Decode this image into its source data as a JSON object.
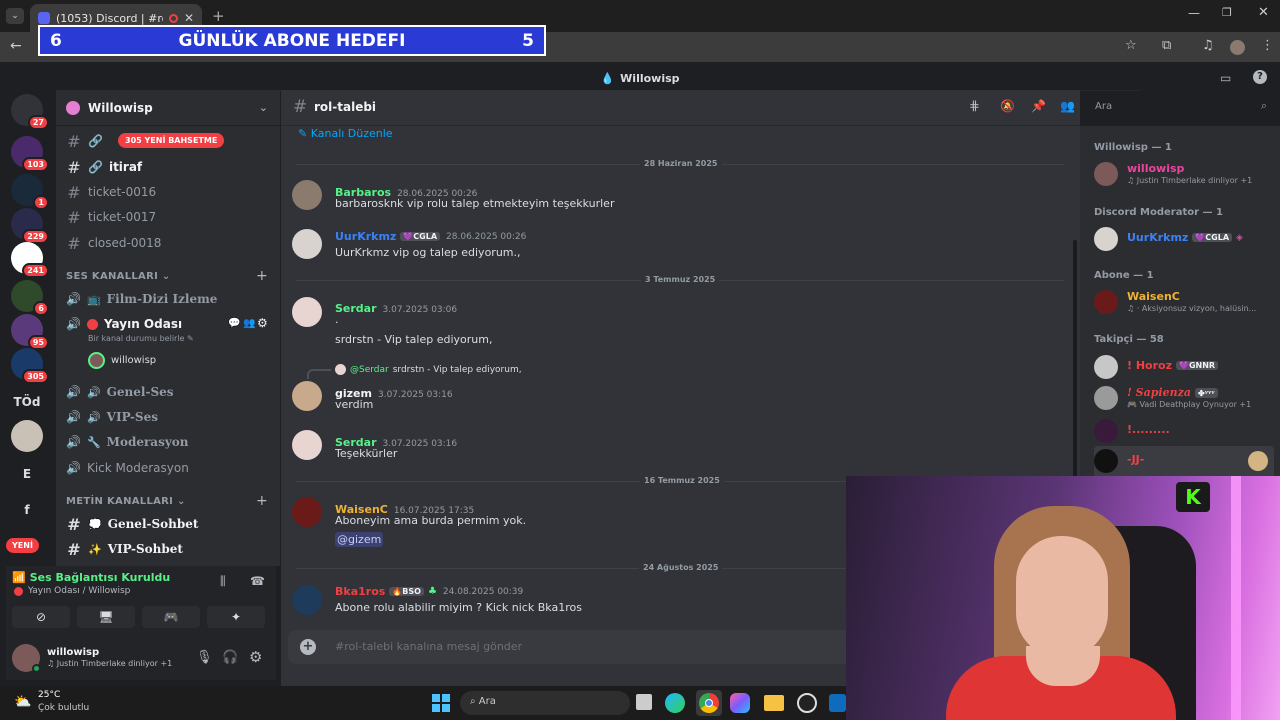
{
  "browser": {
    "tab_title": "(1053) Discord | #rol-talebi"
  },
  "overlay": {
    "left_number": "6",
    "title": "GÜNLÜK ABONE HEDEFI",
    "right_number": "5"
  },
  "app": {
    "window_title": "Willowisp"
  },
  "servers": [
    {
      "badge": "27"
    },
    {
      "badge": "103"
    },
    {
      "badge": "1"
    },
    {
      "badge": "229"
    },
    {
      "badge": "241"
    },
    {
      "badge": "6"
    },
    {
      "badge": "95"
    },
    {
      "badge": "305"
    },
    {
      "label": "TÖd"
    },
    {
      "label": ""
    },
    {
      "label": "E"
    },
    {
      "label": "f"
    }
  ],
  "servers_new_label": "YENİ",
  "server_header": {
    "name": "Willowisp"
  },
  "channels": {
    "mention_pill": "305 YENİ BAHSETME",
    "text_top": [
      {
        "name": "itiraf"
      },
      {
        "name": "ticket-0016"
      },
      {
        "name": "ticket-0017"
      },
      {
        "name": "closed-0018"
      }
    ],
    "voice_category": "SES KANALLARI",
    "voice": [
      {
        "name": "Film-Dizi Izleme"
      },
      {
        "name": "Yayın Odası"
      }
    ],
    "voice_status_hint": "Bir kanal durumu belirle",
    "voice_member": "willowisp",
    "voice_more": [
      {
        "name": "Genel-Ses"
      },
      {
        "name": "VIP-Ses"
      },
      {
        "name": "Moderasyon"
      },
      {
        "name": "Kick Moderasyon"
      }
    ],
    "text_category": "METİN KANALLARI",
    "text_bottom": [
      {
        "name": "Genel-Sohbet"
      },
      {
        "name": "VIP-Sohbet"
      }
    ]
  },
  "voice_panel": {
    "status": "Ses Bağlantısı Kuruldu",
    "location": "Yayın Odası / Willowisp"
  },
  "user_panel": {
    "name": "willowisp",
    "activity": "Justin Timberlake dinliyor +1"
  },
  "chat": {
    "channel": "rol-talebi",
    "edit_channel": "Kanalı Düzenle",
    "search_placeholder": "Ara",
    "composer_placeholder": "#rol-talebi kanalına mesaj gönder",
    "dates": [
      "28 Haziran 2025",
      "3 Temmuz 2025",
      "16 Temmuz 2025",
      "24 Ağustos 2025"
    ],
    "messages": [
      {
        "author": "Barbaros",
        "time": "28.06.2025 00:26",
        "text": "barbarosknk vip rolu talep etmekteyim teşekkurler",
        "color": "#57f287"
      },
      {
        "author": "UurKrkmz",
        "tag": "CGLA",
        "time": "28.06.2025 00:26",
        "text": "UurKrkmz vip og talep ediyorum.,",
        "color": "#3b82f6"
      },
      {
        "author": "Serdar",
        "time": "3.07.2025 03:06",
        "text": ".",
        "text2": "srdrstn - Vip talep ediyorum,",
        "color": "#57f287"
      },
      {
        "reply_author": "@Serdar",
        "reply_text": "srdrstn - Vip talep ediyorum,",
        "author": "gizem",
        "time": "3.07.2025 03:16",
        "text": "verdim",
        "color": "#f2f3f5"
      },
      {
        "author": "Serdar",
        "time": "3.07.2025 03:16",
        "text": "Teşekkürler",
        "color": "#57f287"
      },
      {
        "author": "WaisenC",
        "time": "16.07.2025 17:35",
        "text": "Aboneyim ama burda permim yok.",
        "mention": "@gizem",
        "color": "#f0b232"
      },
      {
        "author": "Bka1ros",
        "tag": "BSO",
        "time": "24.08.2025 00:39",
        "text": "Abone rolu alabilir miyim ? Kick nick Bka1ros",
        "color": "#f23f43"
      }
    ]
  },
  "members": {
    "groups": [
      {
        "title": "Willowisp — 1",
        "items": [
          {
            "name": "willowisp",
            "activity": "Justin Timberlake dinliyor +1",
            "color": "#eb459e"
          }
        ]
      },
      {
        "title": "Discord Moderator — 1",
        "items": [
          {
            "name": "UurKrkmz",
            "tag": "CGLA",
            "color": "#3b82f6"
          }
        ]
      },
      {
        "title": "Abone — 1",
        "items": [
          {
            "name": "WaisenC",
            "activity": "Aksiyonsuz vizyon, halüsin...",
            "color": "#f0b232"
          }
        ]
      },
      {
        "title": "Takipçi — 58",
        "items": [
          {
            "name": "! Horoz",
            "tag": "GNNR",
            "color": "#f23f43"
          },
          {
            "name": "! Sapienza",
            "tag": "ᵞᵞᵞ",
            "activity": "Vadi Deathplay Oynuyor +1",
            "color": "#f23f43"
          },
          {
            "name": "!.........",
            "color": "#f23f43"
          },
          {
            "name": "-JJ-",
            "color": "#f23f43"
          }
        ]
      }
    ]
  },
  "taskbar": {
    "temp": "25°C",
    "weather": "Çok bulutlu",
    "search": "Ara"
  },
  "colors": {
    "accent": "#5865f2",
    "bg": "#313338",
    "sidebar": "#2b2d31",
    "green": "#57f287",
    "red": "#f23f43"
  }
}
